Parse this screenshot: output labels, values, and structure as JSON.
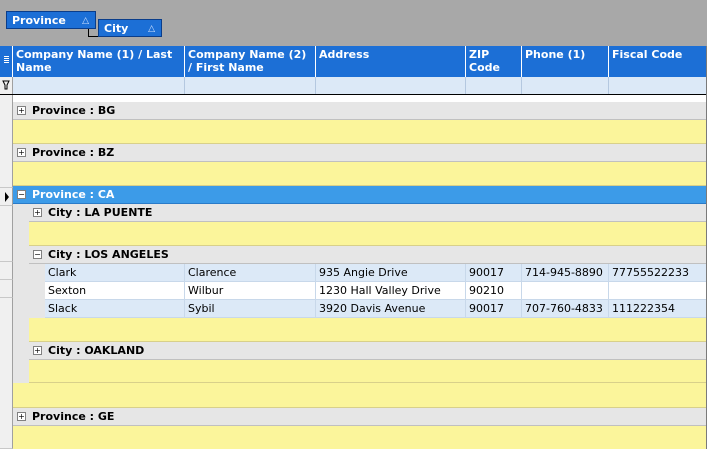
{
  "group_by": [
    {
      "label": "Province",
      "sort_icon": "triangle-up-icon"
    },
    {
      "label": "City",
      "sort_icon": "triangle-up-icon"
    }
  ],
  "columns": [
    {
      "label": "Company Name (1) / Last Name"
    },
    {
      "label": "Company Name (2) / First Name"
    },
    {
      "label": "Address"
    },
    {
      "label": "ZIP Code"
    },
    {
      "label": "Phone (1)"
    },
    {
      "label": "Fiscal Code"
    }
  ],
  "groups": {
    "bg": {
      "label": "Province : BG",
      "expanded": false
    },
    "bz": {
      "label": "Province : BZ",
      "expanded": false
    },
    "ca": {
      "label": "Province : CA",
      "expanded": true,
      "selected": true,
      "cities": {
        "la_puente": {
          "label": "City : LA PUENTE",
          "expanded": false
        },
        "los_angeles": {
          "label": "City : LOS ANGELES",
          "expanded": true
        },
        "oakland": {
          "label": "City : OAKLAND",
          "expanded": false
        }
      }
    },
    "ge": {
      "label": "Province : GE",
      "expanded": false
    }
  },
  "rows": [
    {
      "last": "Clark",
      "first": "Clarence",
      "address": "935 Angie Drive",
      "zip": "90017",
      "phone": "714-945-8890",
      "fiscal": "77755522233"
    },
    {
      "last": "Sexton",
      "first": "Wilbur",
      "address": "1230 Hall Valley Drive",
      "zip": "90210",
      "phone": "",
      "fiscal": ""
    },
    {
      "last": "Slack",
      "first": "Sybil",
      "address": "3920 Davis Avenue",
      "zip": "90017",
      "phone": "707-760-4833",
      "fiscal": "111222354"
    }
  ],
  "colors": {
    "header": "#1c6fd6",
    "selected_group": "#3c9be8",
    "band": "#fbf59b",
    "alt_row": "#dce9f7"
  }
}
